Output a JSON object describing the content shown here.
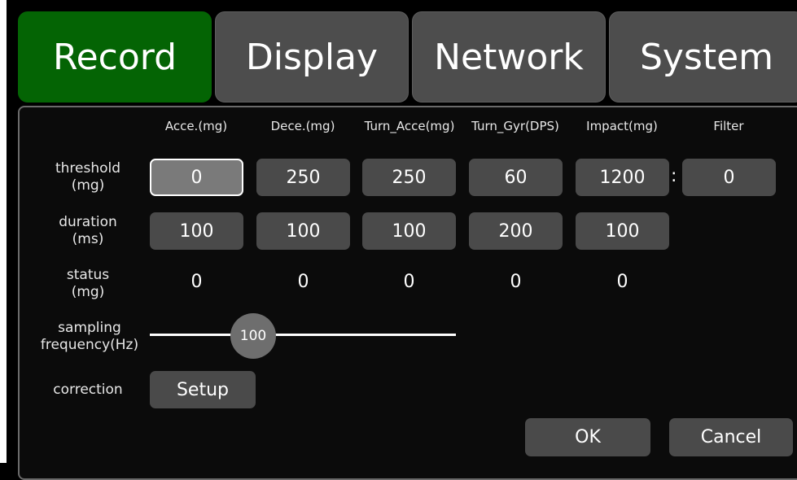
{
  "tabs": [
    {
      "label": "Record",
      "active": true
    },
    {
      "label": "Display",
      "active": false
    },
    {
      "label": "Network",
      "active": false
    },
    {
      "label": "System",
      "active": false
    }
  ],
  "columns": [
    "Acce.(mg)",
    "Dece.(mg)",
    "Turn_Acce(mg)",
    "Turn_Gyr(DPS)",
    "Impact(mg)",
    "Filter"
  ],
  "rows": {
    "threshold": {
      "label_1": "threshold",
      "label_2": "(mg)",
      "values": [
        "0",
        "250",
        "250",
        "60",
        "1200"
      ],
      "filter": "0",
      "separator": ":"
    },
    "duration": {
      "label_1": "duration",
      "label_2": "(ms)",
      "values": [
        "100",
        "100",
        "100",
        "200",
        "100"
      ]
    },
    "status": {
      "label_1": "status",
      "label_2": "(mg)",
      "values": [
        "0",
        "0",
        "0",
        "0",
        "0"
      ]
    },
    "sampling": {
      "label_1": "sampling",
      "label_2": "frequency(Hz)",
      "value": "100"
    },
    "correction": {
      "label": "correction",
      "button": "Setup"
    }
  },
  "footer": {
    "ok": "OK",
    "cancel": "Cancel"
  },
  "colors": {
    "active_tab": "#046404",
    "control": "#4a4a4a",
    "focused_field": "#7a7a7a"
  }
}
